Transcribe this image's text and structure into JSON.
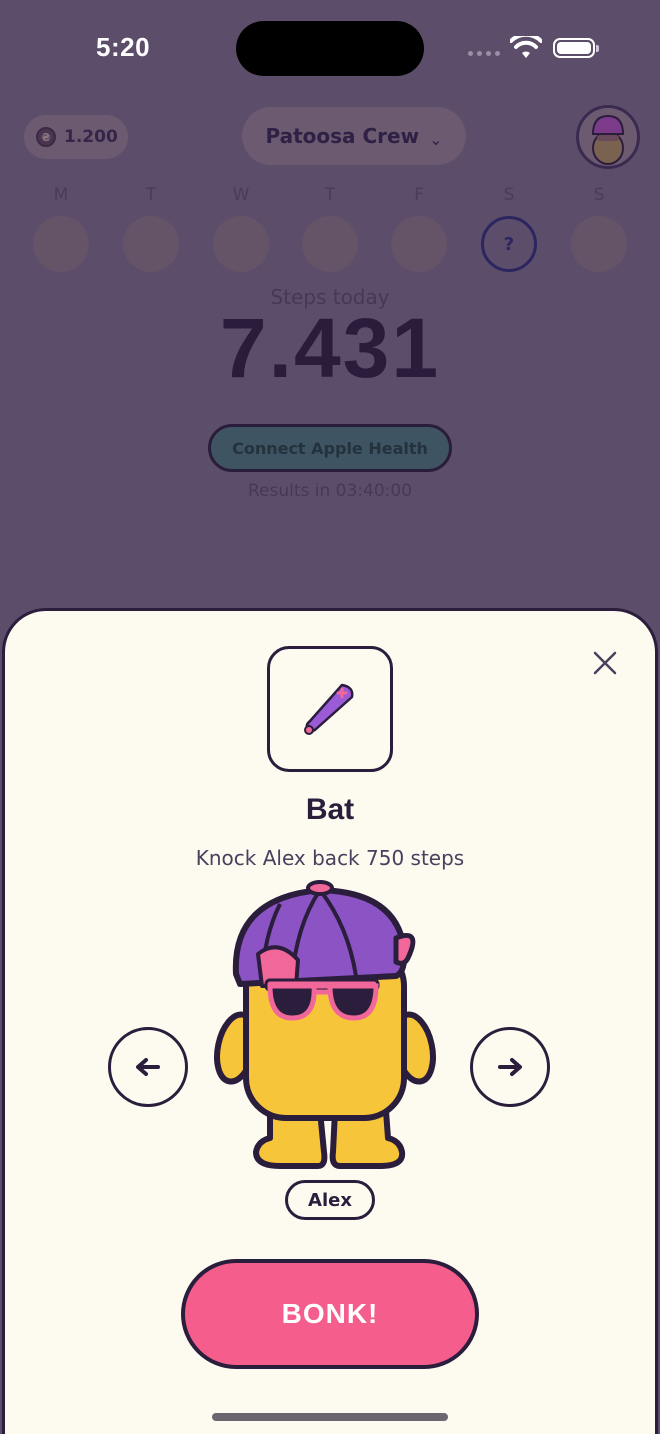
{
  "status_bar": {
    "time": "5:20"
  },
  "header": {
    "coins": "1.200",
    "coin_symbol": "₴",
    "group_name": "Patoosa Crew",
    "group_chevron": "⌄"
  },
  "week": {
    "days": [
      {
        "letter": "M",
        "state": "empty"
      },
      {
        "letter": "T",
        "state": "empty"
      },
      {
        "letter": "W",
        "state": "empty"
      },
      {
        "letter": "T",
        "state": "empty"
      },
      {
        "letter": "F",
        "state": "empty"
      },
      {
        "letter": "S",
        "state": "pending",
        "mark": "?"
      },
      {
        "letter": "S",
        "state": "empty"
      }
    ]
  },
  "steps": {
    "label": "Steps today",
    "value": "7.431"
  },
  "health": {
    "button_label": "Connect Apple Health",
    "results": "Results in 03:40:00"
  },
  "sheet": {
    "item_icon": "baseball-bat-icon",
    "item_title": "Bat",
    "item_description": "Knock Alex back 750 steps",
    "target_name": "Alex",
    "action_label": "BONK!",
    "prev_icon": "arrow-left-icon",
    "next_icon": "arrow-right-icon",
    "close_icon": "close-icon"
  },
  "colors": {
    "overlay": "#5c4e6b",
    "sheet_bg": "#fdfaf0",
    "ink": "#2b1d3c",
    "bonk_pink": "#f45d8c",
    "character_yellow": "#f7c53a",
    "cap_purple": "#8b53c4",
    "accent_pink": "#f2679a"
  }
}
